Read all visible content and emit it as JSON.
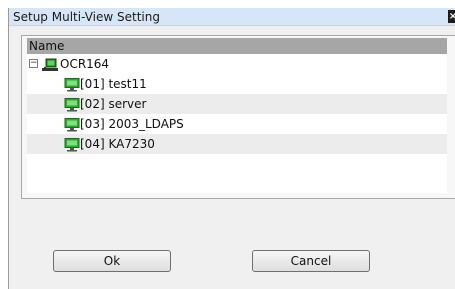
{
  "window": {
    "title": "Setup Multi-View Setting",
    "close_glyph": "×"
  },
  "tree": {
    "column_header": "Name",
    "root": {
      "expander": "−",
      "label": "OCR164",
      "icon": "network-computer-icon"
    },
    "children": [
      {
        "label": "[01] test11",
        "icon": "monitor-icon"
      },
      {
        "label": "[02] server",
        "icon": "monitor-icon"
      },
      {
        "label": "[03] 2003_LDAPS",
        "icon": "monitor-icon"
      },
      {
        "label": "[04] KA7230",
        "icon": "monitor-icon"
      }
    ]
  },
  "buttons": {
    "ok": "Ok",
    "cancel": "Cancel"
  },
  "colors": {
    "title_bar": "#d7e6f7",
    "header": "#a6a6a6",
    "monitor_green": "#2fa82f"
  }
}
